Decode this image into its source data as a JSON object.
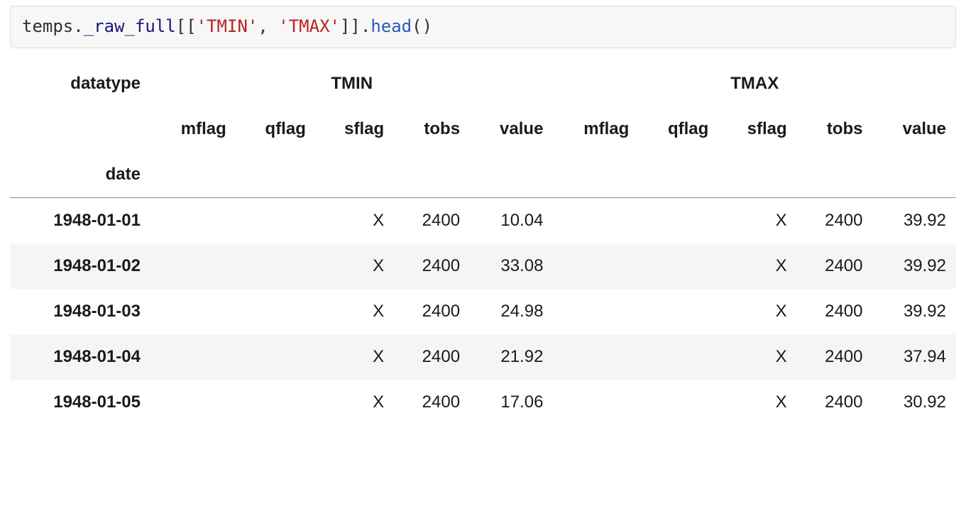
{
  "code": {
    "obj": "temps",
    "dot1": ".",
    "attr": "_raw_full",
    "br_open": "[[",
    "q1": "'TMIN'",
    "comma": ", ",
    "q2": "'TMAX'",
    "br_close": "]]",
    "dot2": ".",
    "call": "head",
    "paren": "()"
  },
  "header": {
    "datatype_label": "datatype",
    "tmin": "TMIN",
    "tmax": "TMAX",
    "sub": [
      "mflag",
      "qflag",
      "sflag",
      "tobs",
      "value"
    ],
    "index_name": "date"
  },
  "rows": [
    {
      "date": "1948-01-01",
      "tmin": {
        "mflag": "",
        "qflag": "",
        "sflag": "X",
        "tobs": "2400",
        "value": "10.04"
      },
      "tmax": {
        "mflag": "",
        "qflag": "",
        "sflag": "X",
        "tobs": "2400",
        "value": "39.92"
      }
    },
    {
      "date": "1948-01-02",
      "tmin": {
        "mflag": "",
        "qflag": "",
        "sflag": "X",
        "tobs": "2400",
        "value": "33.08"
      },
      "tmax": {
        "mflag": "",
        "qflag": "",
        "sflag": "X",
        "tobs": "2400",
        "value": "39.92"
      }
    },
    {
      "date": "1948-01-03",
      "tmin": {
        "mflag": "",
        "qflag": "",
        "sflag": "X",
        "tobs": "2400",
        "value": "24.98"
      },
      "tmax": {
        "mflag": "",
        "qflag": "",
        "sflag": "X",
        "tobs": "2400",
        "value": "39.92"
      }
    },
    {
      "date": "1948-01-04",
      "tmin": {
        "mflag": "",
        "qflag": "",
        "sflag": "X",
        "tobs": "2400",
        "value": "21.92"
      },
      "tmax": {
        "mflag": "",
        "qflag": "",
        "sflag": "X",
        "tobs": "2400",
        "value": "37.94"
      }
    },
    {
      "date": "1948-01-05",
      "tmin": {
        "mflag": "",
        "qflag": "",
        "sflag": "X",
        "tobs": "2400",
        "value": "17.06"
      },
      "tmax": {
        "mflag": "",
        "qflag": "",
        "sflag": "X",
        "tobs": "2400",
        "value": "30.92"
      }
    }
  ]
}
